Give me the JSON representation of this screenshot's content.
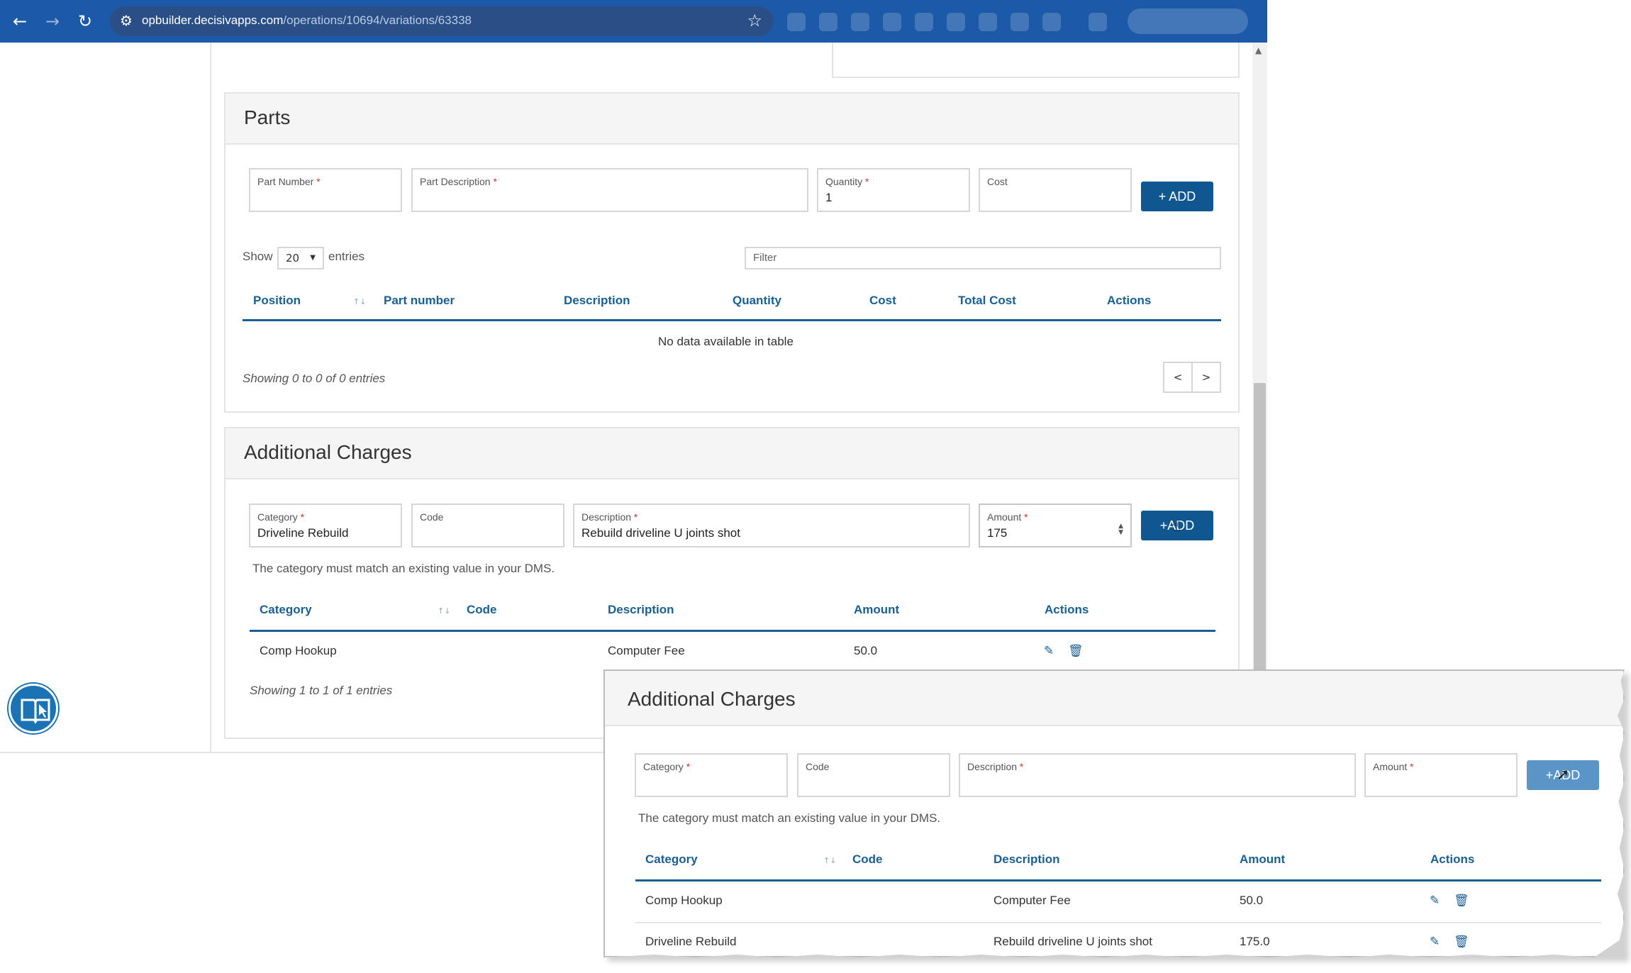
{
  "browser": {
    "url_domain": "opbuilder.decisivapps.com",
    "url_path": "/operations/10694/variations/63338"
  },
  "parts": {
    "title": "Parts",
    "fields": {
      "part_number_label": "Part Number",
      "part_description_label": "Part Description",
      "quantity_label": "Quantity",
      "quantity_value": "1",
      "cost_label": "Cost",
      "required_mark": "*"
    },
    "add_label": "+ ADD",
    "show_label": "Show",
    "entries_select": "20",
    "entries_label": "entries",
    "filter_placeholder": "Filter",
    "columns": [
      "Position",
      "Part number",
      "Description",
      "Quantity",
      "Cost",
      "Total Cost",
      "Actions"
    ],
    "empty_text": "No data available in table",
    "showing": "Showing 0 to 0 of 0 entries",
    "prev": "<",
    "next": ">"
  },
  "charges": {
    "title": "Additional Charges",
    "fields": {
      "category_label": "Category",
      "category_value": "Driveline Rebuild",
      "code_label": "Code",
      "description_label": "Description",
      "description_value": "Rebuild driveline U joints shot",
      "amount_label": "Amount",
      "amount_value": "175"
    },
    "add_label": "+ADD",
    "hint": "The category must match an existing value in your DMS.",
    "columns": [
      "Category",
      "Code",
      "Description",
      "Amount",
      "Actions"
    ],
    "rows": [
      {
        "category": "Comp Hookup",
        "code": "",
        "description": "Computer Fee",
        "amount": "50.0"
      }
    ],
    "showing": "Showing 1 to 1 of 1 entries"
  },
  "zoom": {
    "title": "Additional Charges",
    "fields": {
      "category_label": "Category",
      "code_label": "Code",
      "description_label": "Description",
      "amount_label": "Amount"
    },
    "add_label": "+ADD",
    "hint": "The category must match an existing value in your DMS.",
    "columns": [
      "Category",
      "Code",
      "Description",
      "Amount",
      "Actions"
    ],
    "rows": [
      {
        "category": "Comp Hookup",
        "code": "",
        "description": "Computer Fee",
        "amount": "50.0"
      },
      {
        "category": "Driveline Rebuild",
        "code": "",
        "description": "Rebuild driveline U joints shot",
        "amount": "175.0"
      }
    ]
  },
  "icons": {
    "edit": "pencil-icon",
    "delete": "trash-icon",
    "help": "book-cursor-icon",
    "star": "star-icon"
  },
  "colors": {
    "browser_bar": "#1c5aa8",
    "primary": "#11578f",
    "table_header": "#1a5f93",
    "required": "#d0322c"
  }
}
